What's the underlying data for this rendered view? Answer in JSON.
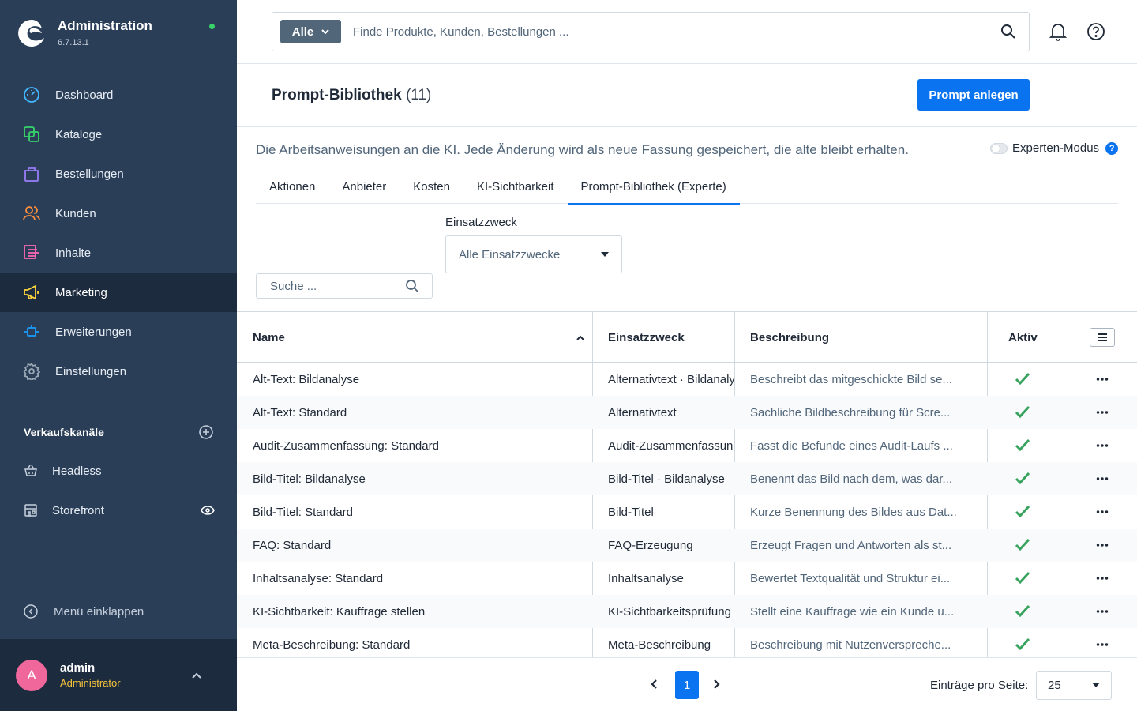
{
  "app": {
    "title": "Administration",
    "version": "6.7.13.1"
  },
  "sidebar": {
    "items": [
      {
        "label": "Dashboard",
        "icon": "dashboard-icon",
        "color": "#43b8ff"
      },
      {
        "label": "Kataloge",
        "icon": "catalog-icon",
        "color": "#37d46a"
      },
      {
        "label": "Bestellungen",
        "icon": "orders-icon",
        "color": "#9a7dfb"
      },
      {
        "label": "Kunden",
        "icon": "customers-icon",
        "color": "#ff8f3d"
      },
      {
        "label": "Inhalte",
        "icon": "content-icon",
        "color": "#ff68b4"
      },
      {
        "label": "Marketing",
        "icon": "marketing-icon",
        "color": "#ffd53d"
      },
      {
        "label": "Erweiterungen",
        "icon": "extensions-icon",
        "color": "#189eff"
      },
      {
        "label": "Einstellungen",
        "icon": "settings-icon",
        "color": "#9aa8b5"
      }
    ],
    "active": "Marketing",
    "channels_title": "Verkaufskanäle",
    "channels": [
      {
        "label": "Headless",
        "icon": "basket-icon"
      },
      {
        "label": "Storefront",
        "icon": "storefront-icon"
      }
    ],
    "collapse_label": "Menü einklappen",
    "user": {
      "initial": "A",
      "name": "admin",
      "role": "Administrator"
    }
  },
  "header": {
    "scope_button": "Alle",
    "search_placeholder": "Finde Produkte, Kunden, Bestellungen ..."
  },
  "page": {
    "title": "Prompt-Bibliothek",
    "count": "(11)",
    "create_button": "Prompt anlegen",
    "description": "Die Arbeitsanweisungen an die KI. Jede Änderung wird als neue Fassung gespeichert, die alte bleibt erhalten.",
    "expert_mode_label": "Experten-Modus",
    "expert_mode_on": false,
    "tabs": [
      "Aktionen",
      "Anbieter",
      "Kosten",
      "KI-Sichtbarkeit",
      "Prompt-Bibliothek (Experte)"
    ],
    "active_tab": "Prompt-Bibliothek (Experte)",
    "filter_label": "Einsatzzweck",
    "filter_value": "Alle Einsatzzwecke",
    "search_placeholder": "Suche ..."
  },
  "table": {
    "columns": [
      "Name",
      "Einsatzzweck",
      "Beschreibung",
      "Aktiv"
    ],
    "sort": {
      "column": "Name",
      "direction": "asc"
    },
    "rows": [
      {
        "name": "Alt-Text: Bildanalyse",
        "purpose": "Alternativtext · Bildanalyse",
        "description": "Beschreibt das mitgeschickte Bild se...",
        "active": true
      },
      {
        "name": "Alt-Text: Standard",
        "purpose": "Alternativtext",
        "description": "Sachliche Bildbeschreibung für Scre...",
        "active": true
      },
      {
        "name": "Audit-Zusammenfassung: Standard",
        "purpose": "Audit-Zusammenfassung",
        "description": "Fasst die Befunde eines Audit-Laufs ...",
        "active": true
      },
      {
        "name": "Bild-Titel: Bildanalyse",
        "purpose": "Bild-Titel · Bildanalyse",
        "description": "Benennt das Bild nach dem, was dar...",
        "active": true
      },
      {
        "name": "Bild-Titel: Standard",
        "purpose": "Bild-Titel",
        "description": "Kurze Benennung des Bildes aus Dat...",
        "active": true
      },
      {
        "name": "FAQ: Standard",
        "purpose": "FAQ-Erzeugung",
        "description": "Erzeugt Fragen und Antworten als st...",
        "active": true
      },
      {
        "name": "Inhaltsanalyse: Standard",
        "purpose": "Inhaltsanalyse",
        "description": "Bewertet Textqualität und Struktur ei...",
        "active": true
      },
      {
        "name": "KI-Sichtbarkeit: Kauffrage stellen",
        "purpose": "KI-Sichtbarkeitsprüfung",
        "description": "Stellt eine Kauffrage wie ein Kunde u...",
        "active": true
      },
      {
        "name": "Meta-Beschreibung: Standard",
        "purpose": "Meta-Beschreibung",
        "description": "Beschreibung mit Nutzenverspreche...",
        "active": true
      }
    ]
  },
  "pagination": {
    "current_page": "1",
    "per_page_label": "Einträge pro Seite:",
    "per_page": "25"
  },
  "colors": {
    "sidebar": "#2b3e58",
    "sidebar_active": "#1d2b3f",
    "primary": "#0a73f0",
    "check": "#37a35c"
  }
}
